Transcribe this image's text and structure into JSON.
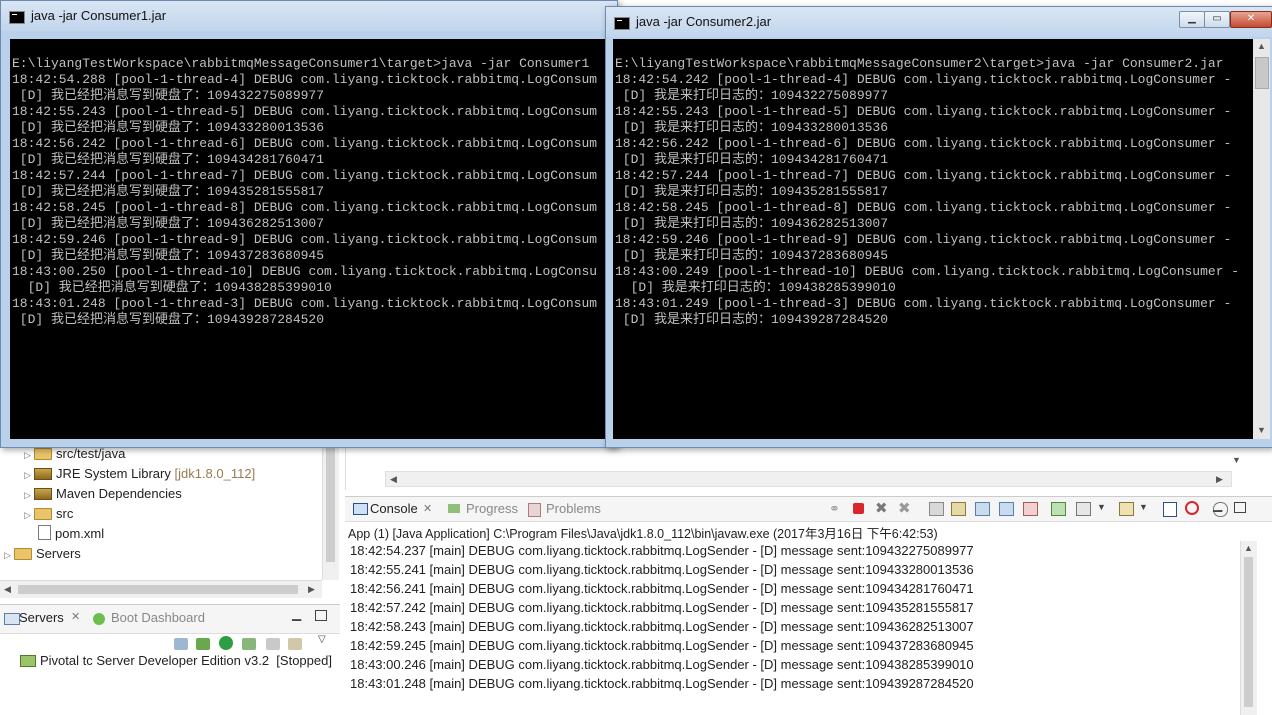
{
  "window1": {
    "title": "java  -jar Consumer1.jar",
    "lines": [
      "E:\\liyangTestWorkspace\\rabbitmqMessageConsumer1\\target>java -jar Consumer1",
      "18:42:54.288 [pool-1-thread-4] DEBUG com.liyang.ticktock.rabbitmq.LogConsum",
      " [D] 我已经把消息写到硬盘了：109432275089977",
      "18:42:55.243 [pool-1-thread-5] DEBUG com.liyang.ticktock.rabbitmq.LogConsum",
      " [D] 我已经把消息写到硬盘了：109433280013536",
      "18:42:56.242 [pool-1-thread-6] DEBUG com.liyang.ticktock.rabbitmq.LogConsum",
      " [D] 我已经把消息写到硬盘了：109434281760471",
      "18:42:57.244 [pool-1-thread-7] DEBUG com.liyang.ticktock.rabbitmq.LogConsum",
      " [D] 我已经把消息写到硬盘了：109435281555817",
      "18:42:58.245 [pool-1-thread-8] DEBUG com.liyang.ticktock.rabbitmq.LogConsum",
      " [D] 我已经把消息写到硬盘了：109436282513007",
      "18:42:59.246 [pool-1-thread-9] DEBUG com.liyang.ticktock.rabbitmq.LogConsum",
      " [D] 我已经把消息写到硬盘了：109437283680945",
      "18:43:00.250 [pool-1-thread-10] DEBUG com.liyang.ticktock.rabbitmq.LogConsu",
      "  [D] 我已经把消息写到硬盘了：109438285399010",
      "18:43:01.248 [pool-1-thread-3] DEBUG com.liyang.ticktock.rabbitmq.LogConsum",
      " [D] 我已经把消息写到硬盘了：109439287284520"
    ]
  },
  "window2": {
    "title": "java  -jar Consumer2.jar",
    "lines": [
      "E:\\liyangTestWorkspace\\rabbitmqMessageConsumer2\\target>java -jar Consumer2.jar",
      "18:42:54.242 [pool-1-thread-4] DEBUG com.liyang.ticktock.rabbitmq.LogConsumer -",
      " [D] 我是来打印日志的：109432275089977",
      "18:42:55.243 [pool-1-thread-5] DEBUG com.liyang.ticktock.rabbitmq.LogConsumer -",
      " [D] 我是来打印日志的：109433280013536",
      "18:42:56.242 [pool-1-thread-6] DEBUG com.liyang.ticktock.rabbitmq.LogConsumer -",
      " [D] 我是来打印日志的：109434281760471",
      "18:42:57.244 [pool-1-thread-7] DEBUG com.liyang.ticktock.rabbitmq.LogConsumer -",
      " [D] 我是来打印日志的：109435281555817",
      "18:42:58.245 [pool-1-thread-8] DEBUG com.liyang.ticktock.rabbitmq.LogConsumer -",
      " [D] 我是来打印日志的：109436282513007",
      "18:42:59.246 [pool-1-thread-9] DEBUG com.liyang.ticktock.rabbitmq.LogConsumer -",
      " [D] 我是来打印日志的：109437283680945",
      "18:43:00.249 [pool-1-thread-10] DEBUG com.liyang.ticktock.rabbitmq.LogConsumer -",
      "  [D] 我是来打印日志的：109438285399010",
      "18:43:01.249 [pool-1-thread-3] DEBUG com.liyang.ticktock.rabbitmq.LogConsumer -",
      " [D] 我是来打印日志的：109439287284520"
    ]
  },
  "tree": {
    "items": [
      {
        "label": "src/test/java",
        "deco": ""
      },
      {
        "label": "JRE System Library",
        "deco": " [jdk1.8.0_112]"
      },
      {
        "label": "Maven Dependencies",
        "deco": ""
      },
      {
        "label": "src",
        "deco": ""
      },
      {
        "label": "pom.xml",
        "deco": ""
      },
      {
        "label": "Servers",
        "deco": ""
      }
    ]
  },
  "servers_panel": {
    "tab_servers": "Servers",
    "tab_boot": "Boot Dashboard",
    "server_name": "Pivotal tc Server Developer Edition v3.2",
    "server_status": "[Stopped]"
  },
  "console": {
    "tab_console": "Console",
    "tab_progress": "Progress",
    "tab_problems": "Problems",
    "description": "App (1) [Java Application] C:\\Program Files\\Java\\jdk1.8.0_112\\bin\\javaw.exe (2017年3月16日 下午6:42:53)",
    "lines": [
      "18:42:54.237 [main] DEBUG com.liyang.ticktock.rabbitmq.LogSender -  [D] message sent:109432275089977",
      "18:42:55.241 [main] DEBUG com.liyang.ticktock.rabbitmq.LogSender -  [D] message sent:109433280013536",
      "18:42:56.241 [main] DEBUG com.liyang.ticktock.rabbitmq.LogSender -  [D] message sent:109434281760471",
      "18:42:57.242 [main] DEBUG com.liyang.ticktock.rabbitmq.LogSender -  [D] message sent:109435281555817",
      "18:42:58.243 [main] DEBUG com.liyang.ticktock.rabbitmq.LogSender -  [D] message sent:109436282513007",
      "18:42:59.245 [main] DEBUG com.liyang.ticktock.rabbitmq.LogSender -  [D] message sent:109437283680945",
      "18:43:00.246 [main] DEBUG com.liyang.ticktock.rabbitmq.LogSender -  [D] message sent:109438285399010",
      "18:43:01.248 [main] DEBUG com.liyang.ticktock.rabbitmq.LogSender -  [D] message sent:109439287284520"
    ]
  },
  "icons": {
    "terminal": "cmd-icon",
    "console_tab": "console-icon",
    "terminate": "terminate-icon",
    "remove": "remove-launch-icon"
  },
  "colors": {
    "terminal_bg": "#000000",
    "terminal_fg": "#c0c0c0",
    "titlebar": "#c1d5ec",
    "close_button": "#c24a31",
    "terminate_red": "#d9262b"
  }
}
